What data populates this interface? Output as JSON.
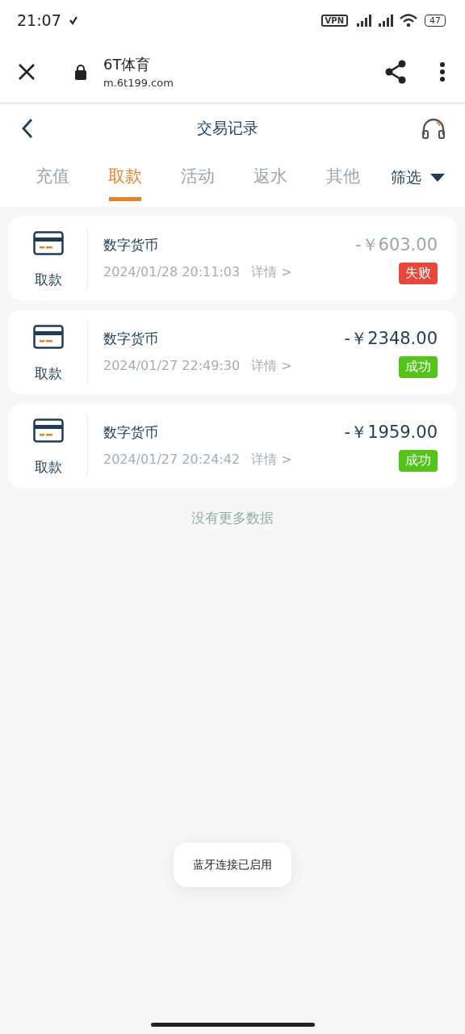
{
  "status_bar": {
    "time": "21:07",
    "battery": "47",
    "vpn": "VPN"
  },
  "browser": {
    "title": "6T体育",
    "url": "m.6t199.com"
  },
  "header": {
    "title": "交易记录"
  },
  "tabs": [
    {
      "label": "充值",
      "selected": false
    },
    {
      "label": "取款",
      "selected": true
    },
    {
      "label": "活动",
      "selected": false
    },
    {
      "label": "返水",
      "selected": false
    },
    {
      "label": "其他",
      "selected": false
    }
  ],
  "filter": {
    "label": "筛选"
  },
  "records": [
    {
      "type": "取款",
      "method": "数字货币",
      "time": "2024/01/28 20:11:03",
      "detail": "详情 >",
      "amount": "-￥603.00",
      "status": {
        "text": "失败",
        "kind": "failed"
      }
    },
    {
      "type": "取款",
      "method": "数字货币",
      "time": "2024/01/27 22:49:30",
      "detail": "详情 >",
      "amount": "-￥2348.00",
      "status": {
        "text": "成功",
        "kind": "success"
      }
    },
    {
      "type": "取款",
      "method": "数字货币",
      "time": "2024/01/27 20:24:42",
      "detail": "详情 >",
      "amount": "-￥1959.00",
      "status": {
        "text": "成功",
        "kind": "success"
      }
    }
  ],
  "end_note": "没有更多数据",
  "toast": "蓝牙连接已启用"
}
